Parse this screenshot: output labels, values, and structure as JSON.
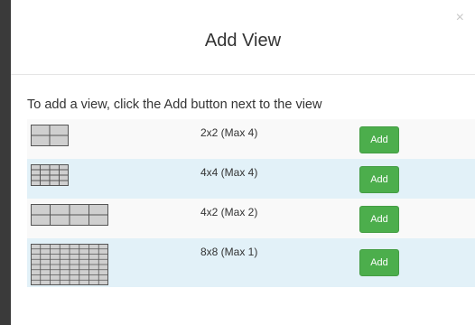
{
  "dialog": {
    "title": "Add View",
    "close_glyph": "×",
    "instruction": "To add a view, click the Add button next to the view"
  },
  "views": [
    {
      "layout": "2x2",
      "label": "2x2 (Max 4)",
      "cols": 2,
      "rows": 2,
      "button_label": "Add"
    },
    {
      "layout": "4x4",
      "label": "4x4 (Max 4)",
      "cols": 4,
      "rows": 4,
      "button_label": "Add"
    },
    {
      "layout": "4x2",
      "label": "4x2 (Max 2)",
      "cols": 4,
      "rows": 2,
      "button_label": "Add"
    },
    {
      "layout": "8x8",
      "label": "8x8 (Max 1)",
      "cols": 8,
      "rows": 8,
      "button_label": "Add"
    }
  ],
  "colors": {
    "accent_green": "#4cae4c",
    "row_alt_blue": "#e2f1f8",
    "thumb_fill": "#cfcfcf",
    "thumb_line": "#555555"
  },
  "icons": {
    "close": "close-icon",
    "thumbnail": "grid-layout-icon"
  }
}
